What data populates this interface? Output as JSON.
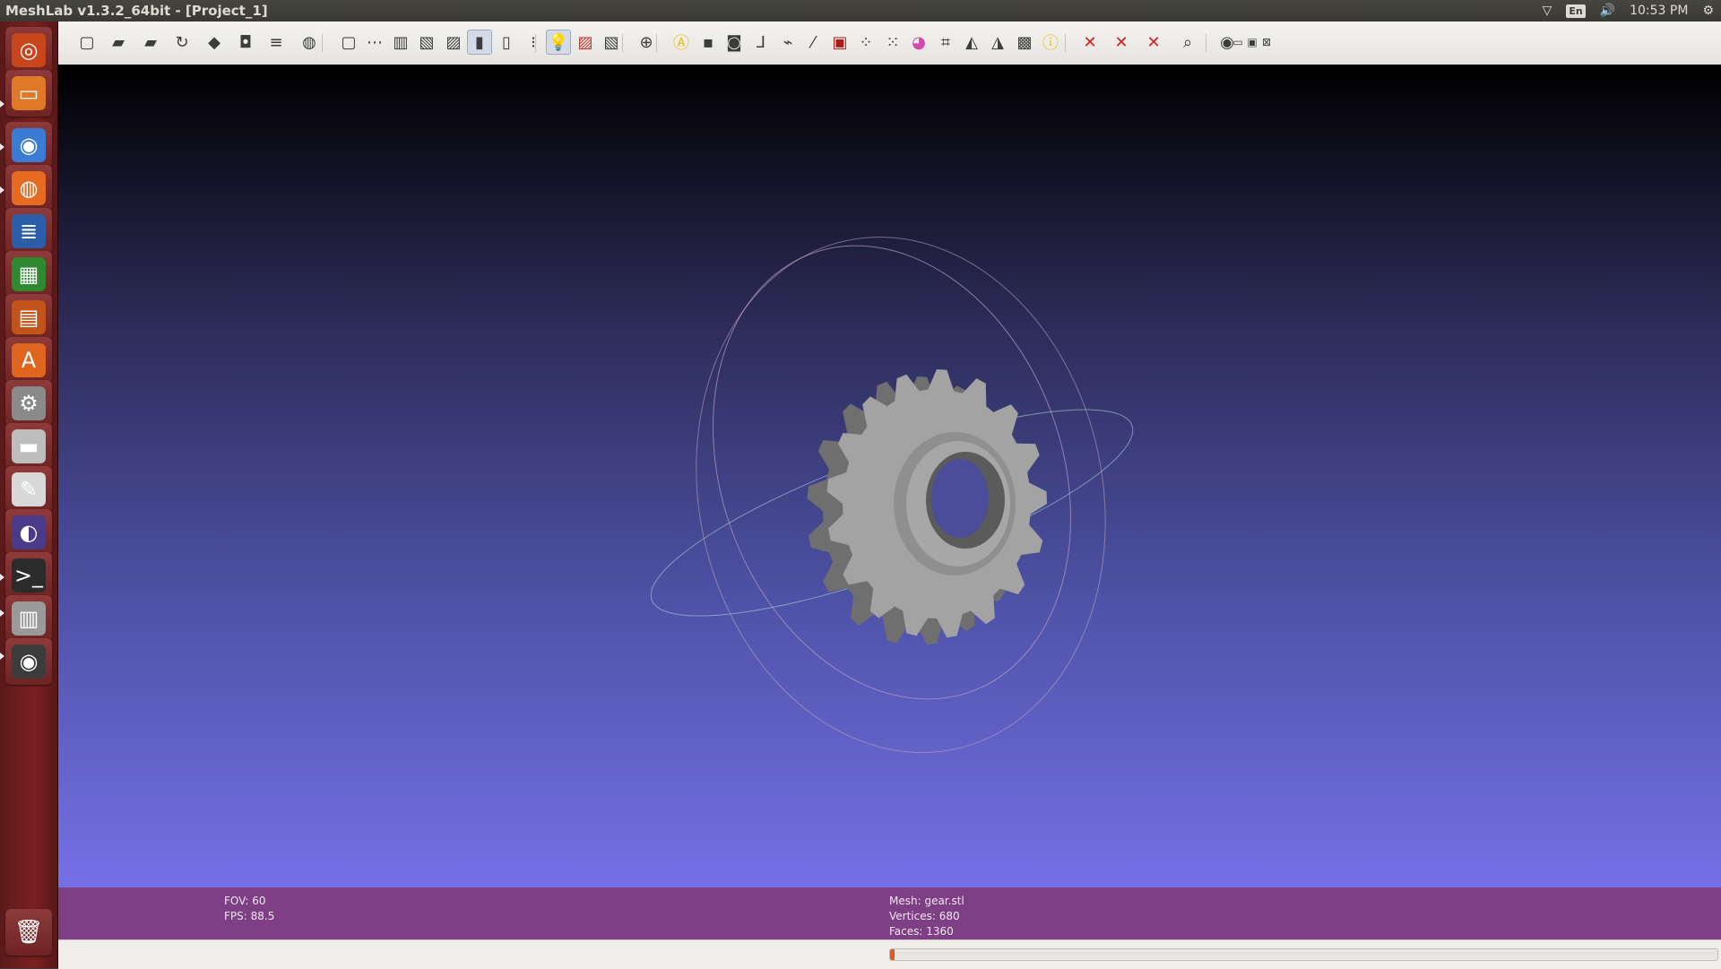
{
  "window": {
    "title": "MeshLab v1.3.2_64bit - [Project_1]"
  },
  "panel": {
    "language": "En",
    "time": "10:53 PM"
  },
  "launcher": [
    {
      "name": "ubuntu-dash-icon",
      "glyph": "◎",
      "color": "#c9451c"
    },
    {
      "name": "files-icon",
      "glyph": "▭",
      "color": "#e0782a"
    },
    {
      "name": "chromium-icon",
      "glyph": "◉",
      "color": "#3a7bd5"
    },
    {
      "name": "firefox-icon",
      "glyph": "◍",
      "color": "#e66a1f"
    },
    {
      "name": "libreoffice-writer-icon",
      "glyph": "≣",
      "color": "#2a5ea8"
    },
    {
      "name": "libreoffice-calc-icon",
      "glyph": "▦",
      "color": "#2f8a2f"
    },
    {
      "name": "libreoffice-impress-icon",
      "glyph": "▤",
      "color": "#c2541a"
    },
    {
      "name": "software-center-icon",
      "glyph": "A",
      "color": "#e0661f"
    },
    {
      "name": "system-settings-icon",
      "glyph": "⚙",
      "color": "#8a8a8a"
    },
    {
      "name": "drive-icon",
      "glyph": "▬",
      "color": "#bdbdbd"
    },
    {
      "name": "text-editor-icon",
      "glyph": "✎",
      "color": "#d8d8d8"
    },
    {
      "name": "eclipse-icon",
      "glyph": "◐",
      "color": "#4a3a8a"
    },
    {
      "name": "terminal-icon",
      "glyph": ">_",
      "color": "#2b2b2b"
    },
    {
      "name": "scanner-icon",
      "glyph": "▥",
      "color": "#9a9a9a"
    },
    {
      "name": "meshlab-eye-icon",
      "glyph": "◉",
      "color": "#3c3c3c"
    }
  ],
  "toolbar": [
    {
      "name": "new-project-icon",
      "glyph": "▢"
    },
    {
      "name": "open-project-icon",
      "glyph": "▰"
    },
    {
      "name": "import-mesh-icon",
      "glyph": "▰"
    },
    {
      "name": "reload-icon",
      "glyph": "↻"
    },
    {
      "name": "save-snapshot-icon",
      "glyph": "◆"
    },
    {
      "name": "camera-icon",
      "glyph": "◘"
    },
    {
      "name": "layers-icon",
      "glyph": "≡"
    },
    {
      "name": "global-icon",
      "glyph": "◍"
    },
    {
      "name": "bounding-box-icon",
      "glyph": "▢"
    },
    {
      "name": "points-icon",
      "glyph": "⋯"
    },
    {
      "name": "wireframe-icon",
      "glyph": "▥"
    },
    {
      "name": "hidden-lines-icon",
      "glyph": "▧"
    },
    {
      "name": "flat-lines-icon",
      "glyph": "▨"
    },
    {
      "name": "flat-icon",
      "glyph": "▮"
    },
    {
      "name": "smooth-icon",
      "glyph": "▯"
    },
    {
      "name": "texture-icon",
      "glyph": "⁝"
    },
    {
      "name": "light-bulb-icon",
      "glyph": "💡"
    },
    {
      "name": "double-side-light-icon",
      "glyph": "▨"
    },
    {
      "name": "back-face-icon",
      "glyph": "▧"
    },
    {
      "name": "trackball-icon",
      "glyph": "⊕"
    },
    {
      "name": "annotation-icon",
      "glyph": "Ⓐ"
    },
    {
      "name": "render-quad-icon",
      "glyph": "▪"
    },
    {
      "name": "noise-icon",
      "glyph": "◙"
    },
    {
      "name": "axes-icon",
      "glyph": "⅃"
    },
    {
      "name": "paint-bucket-icon",
      "glyph": "⌁"
    },
    {
      "name": "paint-brush-icon",
      "glyph": "⁄"
    },
    {
      "name": "pick-points-icon",
      "glyph": "▣"
    },
    {
      "name": "select-vertices-icon",
      "glyph": "⁘"
    },
    {
      "name": "select-faces-icon",
      "glyph": "⁙"
    },
    {
      "name": "color-icon",
      "glyph": "◕"
    },
    {
      "name": "select-region-icon",
      "glyph": "⌗"
    },
    {
      "name": "align-icon",
      "glyph": "◭"
    },
    {
      "name": "measure-icon",
      "glyph": "◮"
    },
    {
      "name": "raster-icon",
      "glyph": "▩"
    },
    {
      "name": "info-icon",
      "glyph": "ⓘ"
    },
    {
      "name": "delete-vertices-icon",
      "glyph": "✕"
    },
    {
      "name": "delete-faces-icon",
      "glyph": "✕"
    },
    {
      "name": "delete-selection-icon",
      "glyph": "✕"
    },
    {
      "name": "search-icon",
      "glyph": "⌕"
    },
    {
      "name": "view-icon",
      "glyph": "◉"
    },
    {
      "name": "window-minimize-icon",
      "glyph": "▭"
    },
    {
      "name": "window-restore-icon",
      "glyph": "▣"
    },
    {
      "name": "window-close-icon",
      "glyph": "⊠"
    }
  ],
  "info": {
    "fov_label": "FOV: 60",
    "fps_label": "FPS:   88.5",
    "mesh_label": "Mesh: gear.stl",
    "vertices_label": "Vertices: 680",
    "faces_label": "Faces: 1360"
  },
  "progress": {
    "value": 0.005
  },
  "colors": {
    "infobar": "#7f3f84",
    "progress": "#e25a1b"
  }
}
